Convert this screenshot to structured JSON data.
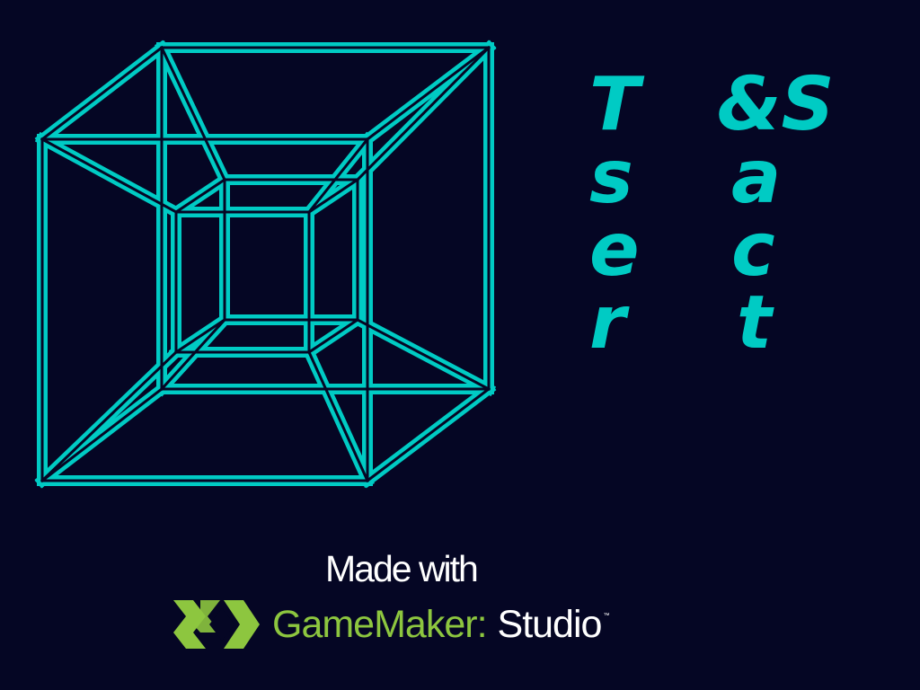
{
  "title": {
    "left": [
      "T",
      "s",
      "e",
      "r"
    ],
    "right": [
      "&S",
      "a",
      "c",
      "t"
    ]
  },
  "splash": {
    "made_with": "Made with",
    "engine_name": "GameMaker:",
    "engine_edition": "Studio",
    "trademark": "™"
  },
  "colors": {
    "background": "#050624",
    "accent": "#00cbc4",
    "engine_green": "#8dc63f",
    "text": "#ffffff"
  },
  "icons": [
    "tesseract-wireframe-icon",
    "gamemaker-logo-icon"
  ]
}
